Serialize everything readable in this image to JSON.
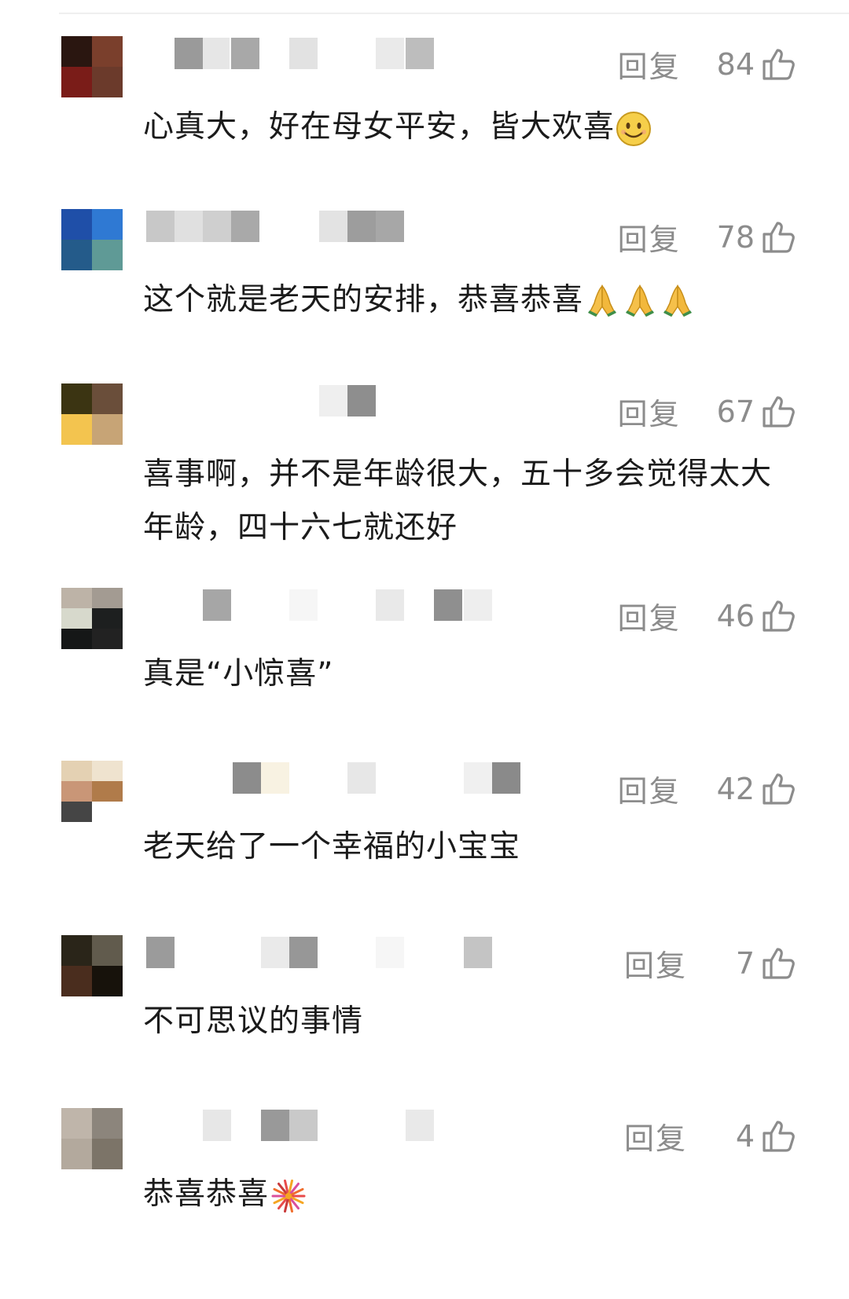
{
  "comments": [
    {
      "reply_label": "回复",
      "likes": "84",
      "text": "心真大，好在母女平安，皆大欢喜",
      "emoji": [
        "smile-emoji"
      ],
      "avatar_colors": [
        "#2a1610",
        "#7a3f2c",
        "#7a1c18",
        "#6b3a2b"
      ],
      "name_blur_colors": [
        "#9a9a9a",
        "#e6e6e6",
        "#a8a8a8",
        "#e2e2e2",
        "#eaeaea",
        "#bdbdbd"
      ]
    },
    {
      "reply_label": "回复",
      "likes": "78",
      "text": "这个就是老天的安排，恭喜恭喜",
      "emoji": [
        "pray-emoji",
        "pray-emoji",
        "pray-emoji"
      ],
      "avatar_colors": [
        "#1f4fa8",
        "#2f79d3",
        "#245b8a",
        "#5f9a96"
      ],
      "name_blur_colors": [
        "#c8c8c8",
        "#e0e0e0",
        "#cfcfcf",
        "#a9a9a9",
        "#e3e3e3",
        "#9d9d9d",
        "#a7a7a7"
      ]
    },
    {
      "reply_label": "回复",
      "likes": "67",
      "text": "喜事啊，并不是年龄很大，五十多会觉得太大年龄，四十六七就还好",
      "emoji": [],
      "avatar_colors": [
        "#3b3412",
        "#6a4e3a",
        "#f3c44f",
        "#c7a476"
      ],
      "name_blur_colors": [
        "#efefef",
        "#8e8e8e"
      ]
    },
    {
      "reply_label": "回复",
      "likes": "46",
      "text": "真是“小惊喜”",
      "emoji": [],
      "avatar_colors": [
        "#bdb3a7",
        "#a39b92",
        "#d7d9cc",
        "#1d1f1f",
        "#151717",
        "#222"
      ],
      "name_blur_colors": [
        "#a6a6a6",
        "#f6f6f6",
        "#e9e9e9",
        "#8f8f8f",
        "#eeeeee"
      ]
    },
    {
      "reply_label": "回复",
      "likes": "42",
      "text": "老天给了一个幸福的小宝宝",
      "emoji": [],
      "avatar_colors": [
        "#e4d1b3",
        "#efe3cf",
        "#c99677",
        "#b07b4a",
        "#454545",
        "#ffffff"
      ],
      "name_blur_colors": [
        "#8c8c8c",
        "#f8f2e2",
        "#e7e7e7",
        "#f0f0f0",
        "#8a8a8a"
      ]
    },
    {
      "reply_label": "回复",
      "likes": "7",
      "text": "不可思议的事情",
      "emoji": [],
      "avatar_colors": [
        "#2a2519",
        "#615b4d",
        "#4a2d1e",
        "#17120b"
      ],
      "name_blur_colors": [
        "#9b9b9b",
        "#eaeaea",
        "#979797",
        "#f6f6f6",
        "#c4c4c4"
      ]
    },
    {
      "reply_label": "回复",
      "likes": "4",
      "text": "恭喜恭喜",
      "emoji": [
        "fireworks-emoji"
      ],
      "avatar_colors": [
        "#bfb5aa",
        "#8c857c",
        "#b3a99d",
        "#7c7468"
      ],
      "name_blur_colors": [
        "#e7e7e7",
        "#999999",
        "#c9c9c9",
        "#e9e9e9"
      ]
    }
  ]
}
